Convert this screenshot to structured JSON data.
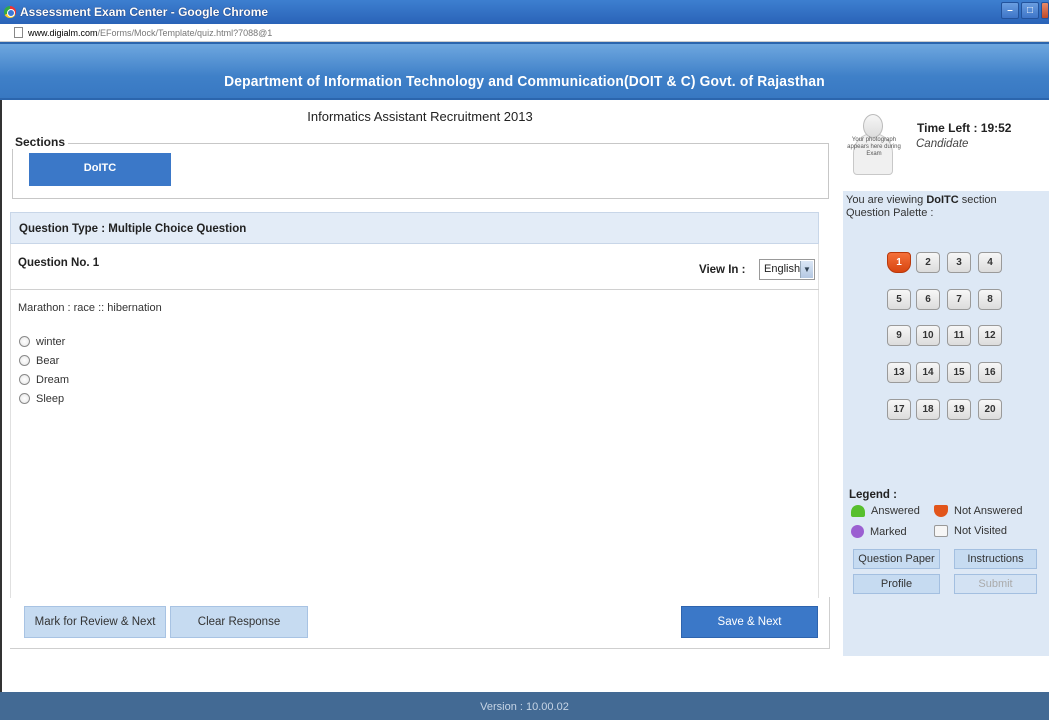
{
  "window": {
    "title": "Assessment Exam Center - Google Chrome",
    "url_host": "www.digialm.com",
    "url_path": "/EForms/Mock/Template/quiz.html?7088@1"
  },
  "header": {
    "title": "Department of Information Technology and Communication(DOIT & C) Govt. of Rajasthan"
  },
  "exam": {
    "title": "Informatics Assistant Recruitment 2013",
    "sections_label": "Sections",
    "sections": [
      "DoITC"
    ]
  },
  "question": {
    "type_label": "Question Type : Multiple Choice Question",
    "number_label": "Question No. 1",
    "view_in_label": "View In :",
    "language": "English",
    "text": "Marathon : race :: hibernation",
    "options": [
      "winter",
      "Bear",
      "Dream",
      "Sleep"
    ]
  },
  "buttons": {
    "mark_review": "Mark for Review & Next",
    "clear_response": "Clear Response",
    "save_next": "Save & Next"
  },
  "candidate": {
    "photo_caption": "Your photograph appears here during Exam",
    "time_left": "Time Left : 19:52",
    "name": "Candidate"
  },
  "palette": {
    "viewing_prefix": "You are viewing",
    "section": "DoITC",
    "viewing_suffix": "section",
    "palette_label": "Question Palette :",
    "current": 1,
    "numbers": [
      "1",
      "2",
      "3",
      "4",
      "5",
      "6",
      "7",
      "8",
      "9",
      "10",
      "11",
      "12",
      "13",
      "14",
      "15",
      "16",
      "17",
      "18",
      "19",
      "20"
    ]
  },
  "legend": {
    "title": "Legend :",
    "answered": "Answered",
    "not_answered": "Not Answered",
    "marked": "Marked",
    "not_visited": "Not Visited"
  },
  "side_buttons": {
    "question_paper": "Question Paper",
    "instructions": "Instructions",
    "profile": "Profile",
    "submit": "Submit"
  },
  "footer": {
    "version": "Version : 10.00.02"
  },
  "colors": {
    "header_blue": "#3f80c8",
    "button_blue": "#3b78c8",
    "not_answered": "#e2551b",
    "answered": "#57bf2d",
    "marked": "#9b5fd1"
  }
}
